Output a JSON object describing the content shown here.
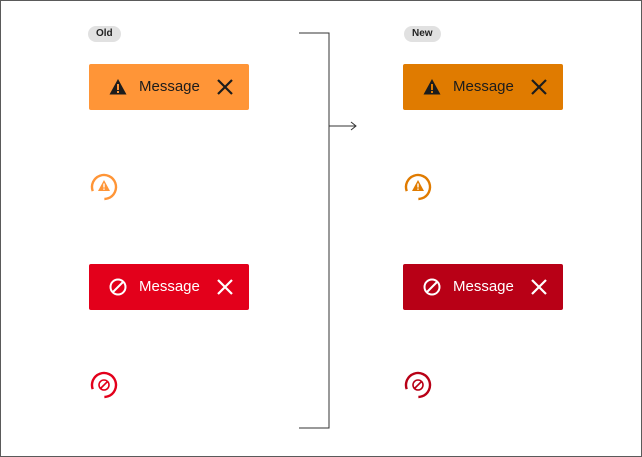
{
  "columns": {
    "old": {
      "label": "Old",
      "warning": {
        "message": "Message",
        "background": "#ff9537",
        "icon": "warning-triangle-icon",
        "ring_color": "#ff9537"
      },
      "error": {
        "message": "Message",
        "background": "#e3001b",
        "icon": "blocked-circle-icon",
        "ring_color": "#e3001b"
      }
    },
    "new": {
      "label": "New",
      "warning": {
        "message": "Message",
        "background": "#e07b00",
        "icon": "warning-triangle-icon",
        "ring_color": "#e07b00"
      },
      "error": {
        "message": "Message",
        "background": "#b80016",
        "icon": "blocked-circle-icon",
        "ring_color": "#b80016"
      }
    }
  },
  "connector": {
    "icon": "arrow-right-icon"
  }
}
